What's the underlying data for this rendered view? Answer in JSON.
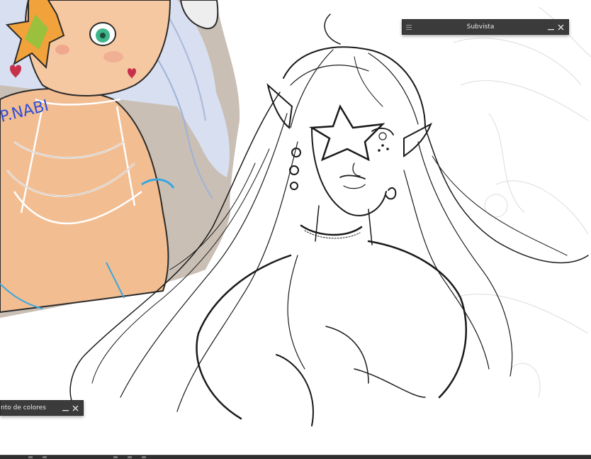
{
  "subview_panel": {
    "title": "Subvista",
    "menu_icon": "hamburger-menu-icon",
    "minimize_icon": "minimize-icon",
    "close_icon": "close-icon"
  },
  "color_panel": {
    "title": "nto de colores",
    "minimize_icon": "minimize-icon",
    "close_icon": "close-icon"
  },
  "reference_image": {
    "signature_text": "P.NABI"
  },
  "colors": {
    "panel_bg": "#3b3b3b",
    "panel_text": "#e8e8e8",
    "canvas_bg": "#ffffff",
    "reference_bg": "#c9bfb4",
    "skin": "#f2bd91",
    "hair": "#c8d4ea",
    "star": "#f2a23a"
  }
}
